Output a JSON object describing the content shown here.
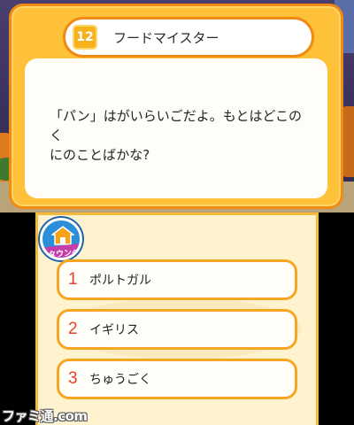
{
  "quiz": {
    "number": "12",
    "title": "フードマイスター",
    "question": "「パン」はがいらいごだよ。もとはどこのく\nにのことばかな?"
  },
  "town_button": {
    "label": "タウンへ"
  },
  "options": [
    {
      "number": "1",
      "label": "ポルトガル"
    },
    {
      "number": "2",
      "label": "イギリス"
    },
    {
      "number": "3",
      "label": "ちゅうごく"
    }
  ],
  "watermark": {
    "text": "ファミ通.com"
  },
  "colors": {
    "frame_orange": "#f08a12",
    "frame_fill": "#ffc13a",
    "option_border": "#f5a623",
    "number_red": "#e8412a",
    "town_blue": "#2a8fd8",
    "town_label_magenta": "#c53da8"
  }
}
